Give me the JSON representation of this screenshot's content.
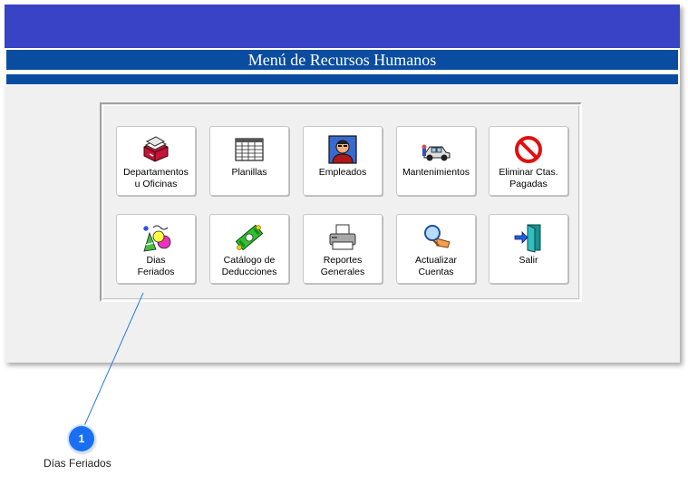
{
  "window": {
    "title": "Menú de Recursos Humanos"
  },
  "buttons": [
    {
      "id": "departamentos",
      "label": "Departamentos\nu Oficinas",
      "icon": "file-box-icon"
    },
    {
      "id": "planillas",
      "label": "Planillas",
      "icon": "spreadsheet-icon"
    },
    {
      "id": "empleados",
      "label": "Empleados",
      "icon": "employee-icon"
    },
    {
      "id": "mantenimientos",
      "label": "Mantenimientos",
      "icon": "car-repair-icon"
    },
    {
      "id": "eliminar",
      "label": "Eliminar Ctas.\nPagadas",
      "icon": "no-entry-icon"
    },
    {
      "id": "dias-feriados",
      "label": "Dias\nFeriados",
      "icon": "party-icon"
    },
    {
      "id": "catalogo",
      "label": "Catálogo de\nDeducciones",
      "icon": "money-icon"
    },
    {
      "id": "reportes",
      "label": "Reportes\nGenerales",
      "icon": "printer-icon"
    },
    {
      "id": "actualizar",
      "label": "Actualizar\nCuentas",
      "icon": "magnifier-hand-icon"
    },
    {
      "id": "salir",
      "label": "Salir",
      "icon": "exit-door-icon"
    }
  ],
  "callout": {
    "number": "1",
    "text": "Días Feriados"
  }
}
